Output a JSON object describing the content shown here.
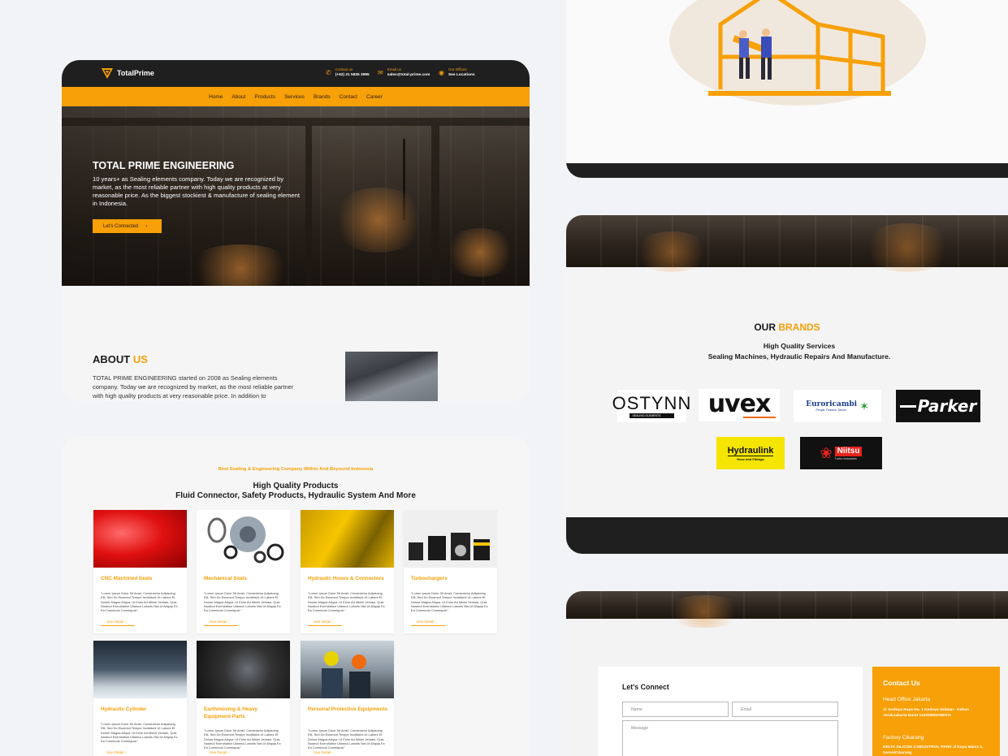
{
  "colors": {
    "accent": "#f7a008",
    "dark": "#1f1f1f",
    "background": "#f2f3f7"
  },
  "header": {
    "logo_text": "TotalPrime",
    "contact": {
      "label": "Contact us",
      "value": "(+62) 21 5835 3995",
      "icon": "phone-icon"
    },
    "email": {
      "label": "Email us",
      "value": "sales@total-prime.com",
      "icon": "mail-icon"
    },
    "offices": {
      "label": "Our Offices",
      "value": "See Locations",
      "icon": "location-pin-icon"
    }
  },
  "nav": {
    "items": [
      "Home",
      "About",
      "Products",
      "Services",
      "Brands",
      "Contact",
      "Career"
    ]
  },
  "hero": {
    "title": "TOTAL PRIME ENGINEERING",
    "text": "10 years+ as Sealing elements company. Today we are recognized by market, as the most reliable partner with high quality products at very reasonable price. As the biggest stockiest & manufacture of sealing element in Indonesia.",
    "button_label": "Let's Connected",
    "button_icon": "chevron-right-icon"
  },
  "about": {
    "title_main": "ABOUT",
    "title_accent": "US",
    "text": "TOTAL PRIME ENGINEERING started on 2008 as Sealing elements company. Today we are recognized by market, as the most reliable partner with high quality products at very reasonable price. In addition to"
  },
  "products": {
    "eyebrow": "Best Sealing & Engineering Company Within And Beyound Indonesia",
    "heading_line1": "High Quality Products",
    "heading_line2": "Fluid Connector, Safety Products, Hydraulic System And More",
    "link_label": "See Detail",
    "description": "\"Lorem Ipsum Dolor Sit Amet, Consectetur Adipiscing Elit, Sed Do Eiusmod Tempor Incididunt Ut Labore Et Dolore Magna Aliqua. Ut Enim Ad Minim Veniam, Quis Nostrud Exercitation Ullamco Laboris Nisi Ut Aliquip Ex Ea Commodo Consequat.\"",
    "items": [
      {
        "name": "CNC Machined Seals"
      },
      {
        "name": "Mechanical Seals"
      },
      {
        "name": "Hydraulic Hoses & Connectors"
      },
      {
        "name": "Turbochargers"
      },
      {
        "name": "Hydraulic Cylinder"
      },
      {
        "name": "Earthmoving & Heavy Equipment Parts"
      },
      {
        "name": "Personal Protective Equipments"
      }
    ]
  },
  "brands": {
    "title_main": "OUR",
    "title_accent": "BRANDS",
    "sub_line1": "High Quality Services",
    "sub_line2": "Sealing Machines, Hydraulic Repairs And Manufacture.",
    "logos": [
      {
        "name": "OSTYNN",
        "tagline": "SEALING ELEMENTS"
      },
      {
        "name": "uvex"
      },
      {
        "name": "Euroricambi",
        "tagline": "People. Passion. Desire."
      },
      {
        "name": "Parker"
      },
      {
        "name": "Hydraulink",
        "tagline": "Hose and Fittings"
      },
      {
        "name": "Niitsu",
        "tagline": "Turbo Industries"
      }
    ]
  },
  "contact_form": {
    "title": "Let's Connect",
    "name_placeholder": "Name",
    "email_placeholder": "Email",
    "message_placeholder": "Message"
  },
  "contact_us": {
    "title": "Contact Us",
    "office1_label": "Head Office Jakarta",
    "office1_address": "Jl. Kedoya Raya No. 1 Kedoya Selatan - Kebon JerukJakarta Barat 11520INDONESIA",
    "office2_label": "Factory Cikarang",
    "office2_address": "DELTA SILICON 3 INDUSTRIAL PARK Jl Kayu Manis 1, SeroniCikarang"
  }
}
